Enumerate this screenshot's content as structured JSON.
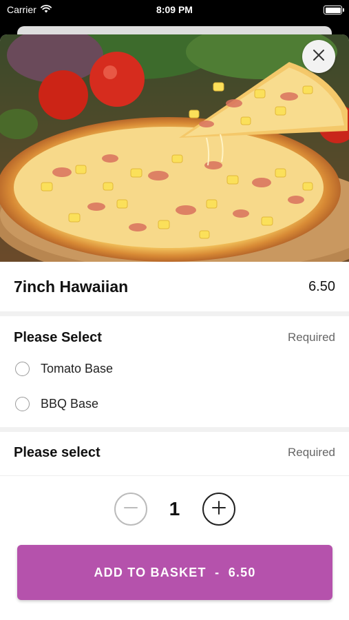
{
  "status_bar": {
    "carrier": "Carrier",
    "time": "8:09 PM"
  },
  "product": {
    "title": "7inch Hawaiian",
    "price": "6.50",
    "image_alt": "pizza-photo"
  },
  "option_groups": [
    {
      "title": "Please Select",
      "status": "Required",
      "options": [
        "Tomato Base",
        "BBQ Base"
      ]
    },
    {
      "title": "Please select",
      "status": "Required",
      "options": []
    }
  ],
  "quantity": {
    "value": "1"
  },
  "add_button": {
    "label": "ADD TO BASKET",
    "separator": "  -  ",
    "price": "6.50"
  },
  "colors": {
    "accent": "#b552ac",
    "background": "#000000",
    "divider": "#f1f1f1"
  }
}
